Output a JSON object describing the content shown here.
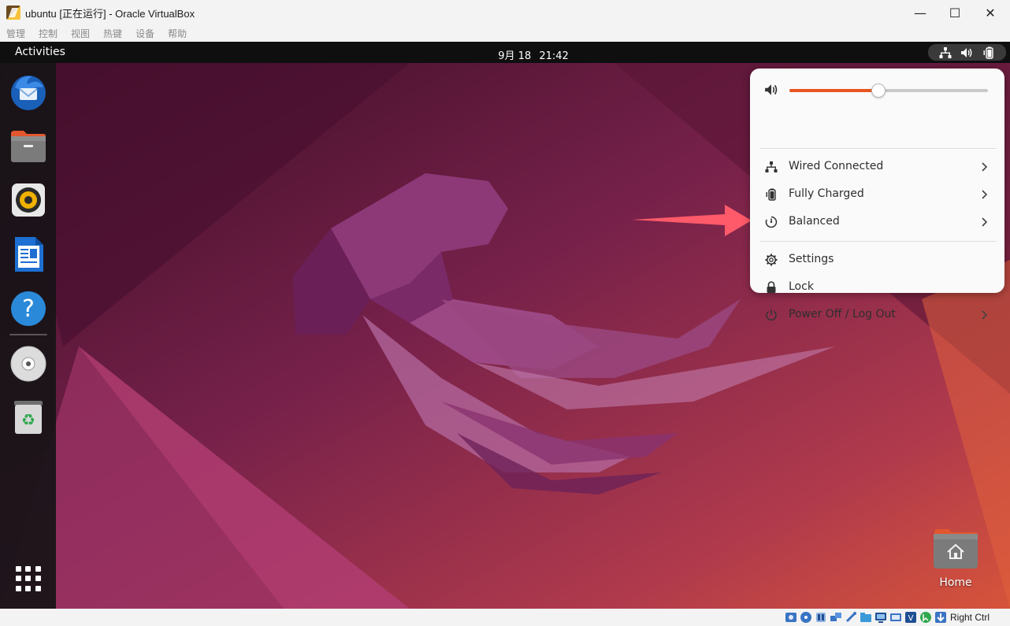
{
  "window": {
    "title": "ubuntu [正在运行] - Oracle VirtualBox",
    "minimize_glyph": "—",
    "maximize_glyph": "☐",
    "close_glyph": "✕"
  },
  "menubar": {
    "items": [
      "管理",
      "控制",
      "视图",
      "热键",
      "设备",
      "帮助"
    ]
  },
  "topbar": {
    "activities": "Activities",
    "date": "9月 18",
    "time": "21:42"
  },
  "dock": {
    "items": [
      {
        "name": "thunderbird-icon"
      },
      {
        "name": "files-icon"
      },
      {
        "name": "rhythmbox-icon"
      },
      {
        "name": "libreoffice-writer-icon"
      },
      {
        "name": "help-icon"
      },
      {
        "name": "dvd-drive-icon"
      },
      {
        "name": "trash-icon"
      },
      {
        "name": "show-apps-icon"
      }
    ]
  },
  "quick_settings": {
    "volume_level": 0.45,
    "rows": [
      {
        "label": "Wired Connected",
        "icon": "network-wired-icon",
        "submenu": true
      },
      {
        "label": "Fully Charged",
        "icon": "battery-icon",
        "submenu": true
      },
      {
        "label": "Balanced",
        "icon": "power-profile-icon",
        "submenu": true
      },
      {
        "label": "Settings",
        "icon": "gear-icon",
        "submenu": false
      },
      {
        "label": "Lock",
        "icon": "lock-icon",
        "submenu": false
      },
      {
        "label": "Power Off / Log Out",
        "icon": "power-icon",
        "submenu": true
      }
    ]
  },
  "desktop": {
    "home_label": "Home"
  },
  "statusbar": {
    "host_key": "Right Ctrl"
  },
  "colors": {
    "accent": "#e95420",
    "annotation_arrow": "#ff5a6a",
    "topbar": "#0f0f0f",
    "menu_bg": "#fafafa"
  }
}
